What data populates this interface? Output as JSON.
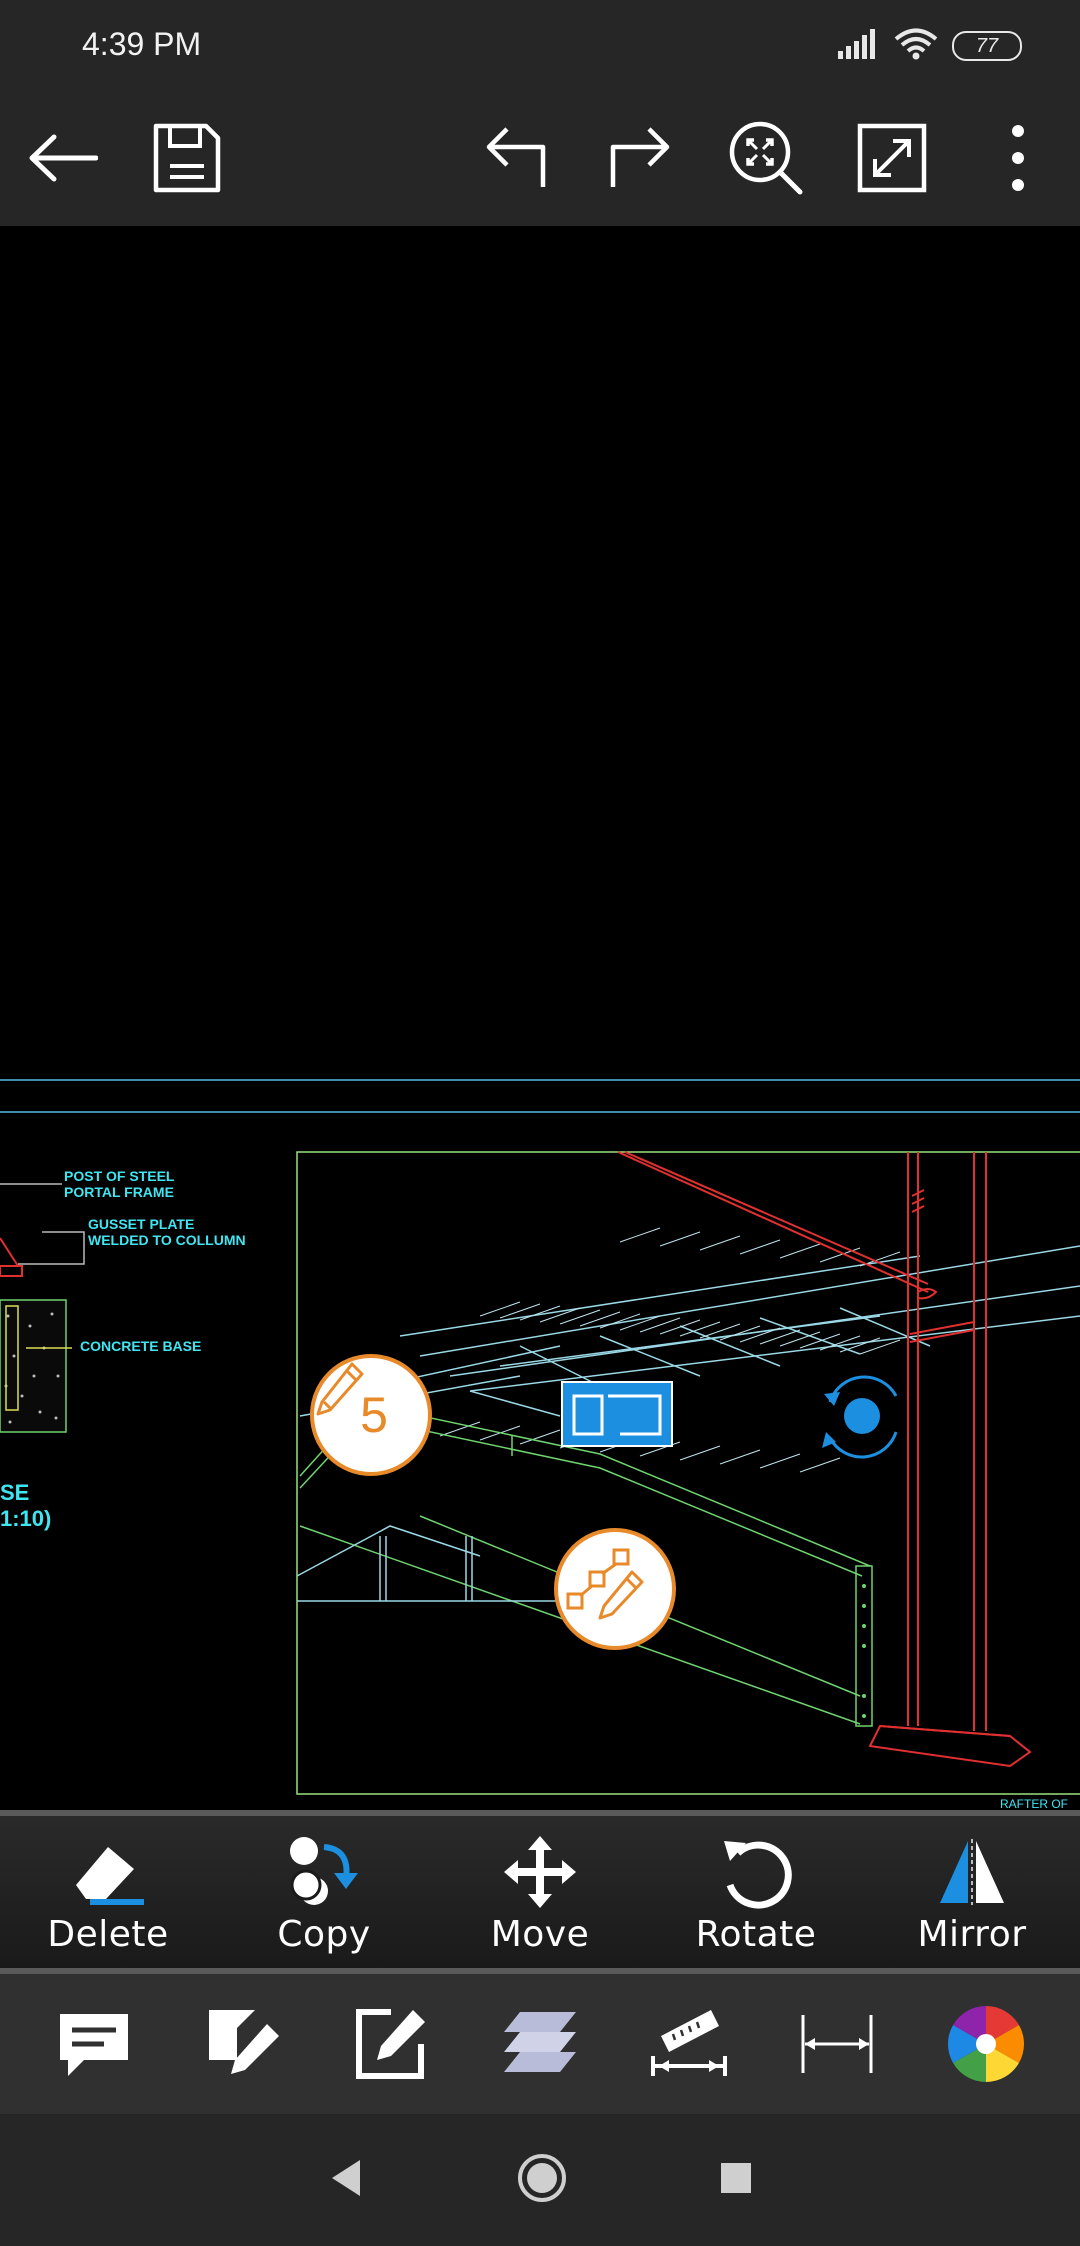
{
  "status": {
    "time": "4:39 PM",
    "battery": "77"
  },
  "toolbar": {
    "back": "back-arrow-icon",
    "save": "floppy-disk-icon",
    "undo": "undo-icon",
    "redo": "redo-icon",
    "zoom_extents": "zoom-extents-icon",
    "fullscreen": "fullscreen-icon",
    "more": "more-vertical-icon"
  },
  "drawing": {
    "labels": {
      "post": "POST OF STEEL\nPORTAL FRAME",
      "gusset": "GUSSET PLATE\nWELDED TO COLLUMN",
      "concrete": "CONCRETE BASE",
      "section_a": "SE",
      "section_b": "1:10)",
      "rafter": "RAFTER OF"
    },
    "edit_points_badge": "5"
  },
  "edit_actions": [
    {
      "label": "Delete",
      "icon": "eraser-icon"
    },
    {
      "label": "Copy",
      "icon": "copy-icon"
    },
    {
      "label": "Move",
      "icon": "move-icon"
    },
    {
      "label": "Rotate",
      "icon": "rotate-icon"
    },
    {
      "label": "Mirror",
      "icon": "mirror-icon"
    }
  ],
  "tools": [
    "comment-icon",
    "draw-icon",
    "edit-icon",
    "layers-icon",
    "measure-icon",
    "dimension-icon",
    "color-wheel-icon"
  ],
  "colors": {
    "accent_blue": "#1c8fe0",
    "orange": "#e88a2a",
    "cad_cyan": "#3fe6f2",
    "cad_red": "#e03030",
    "cad_green": "#6fd36f"
  }
}
